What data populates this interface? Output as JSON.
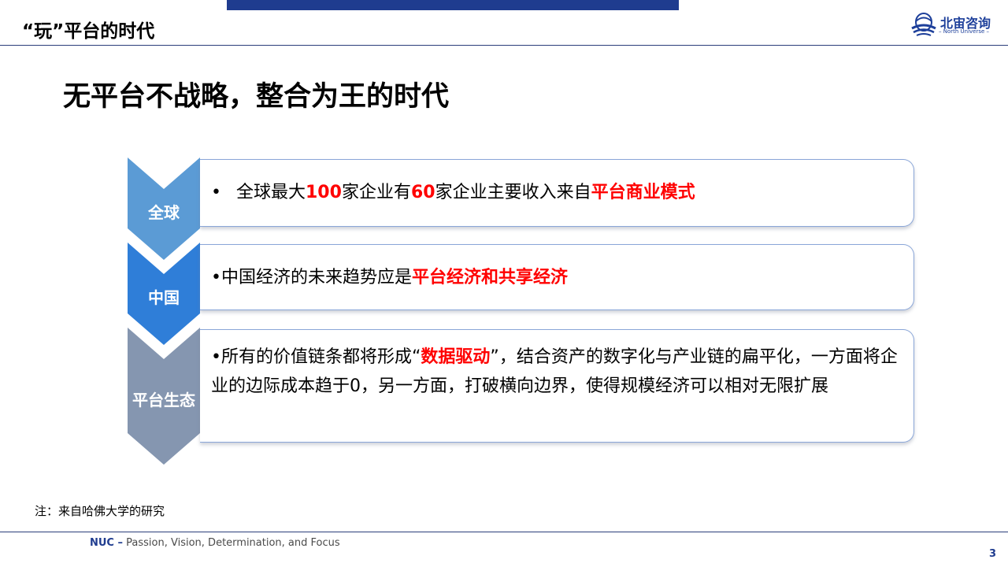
{
  "header": {
    "section_title": "“玩”平台的时代",
    "logo_cn": "北宙咨询",
    "logo_en": "– North Universe –"
  },
  "headline": "无平台不战略，整合为王的时代",
  "rows": [
    {
      "label": "全球",
      "bullet": "•",
      "segments": [
        "全球最大",
        "100",
        "家企业有",
        "60",
        "家企业主要收入来自",
        "平台商业模式"
      ]
    },
    {
      "label": "中国",
      "bullet": "•",
      "segments": [
        "中国经济的未来趋势应是",
        "平台经济和共享经济"
      ]
    },
    {
      "label": "平台生态",
      "bullet": "•",
      "segments": [
        "所有的价值链条都将形成",
        "“",
        "数据驱动",
        "”",
        "，结合资产的数字化与产业链的扁平化，一方面将企业的边际成本趋于0，另一方面，打破横向边界，使得规模经济可以相对无限扩展"
      ]
    }
  ],
  "note": "注：来自哈佛大学的研究",
  "footer": {
    "brand": "NUC –",
    "tagline": "Passion, Vision, Determination, and Focus"
  },
  "page_number": "3",
  "colors": {
    "accent_navy": "#1f3c8f",
    "chevron_global": "#5b9bd5",
    "chevron_china": "#2f7ed8",
    "chevron_platform": "#8596b0",
    "highlight_red": "#ff0000"
  }
}
